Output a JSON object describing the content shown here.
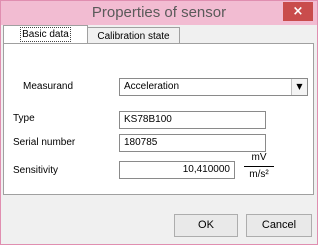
{
  "window": {
    "title": "Properties of sensor",
    "close_glyph": "×"
  },
  "tabs": [
    {
      "label": "Basic data",
      "selected": true
    },
    {
      "label": "Calibration state",
      "selected": false
    }
  ],
  "form": {
    "measurand_label": "Measurand",
    "measurand_value": "Acceleration",
    "type_label": "Type",
    "type_value": "KS78B100",
    "serial_label": "Serial number",
    "serial_value": "180785",
    "sensitivity_label": "Sensitivity",
    "sensitivity_value": "10,410000",
    "unit_numerator": "mV",
    "unit_denominator": "m/s²"
  },
  "buttons": {
    "ok_label": "OK",
    "cancel_label": "Cancel"
  },
  "icons": {
    "combo_arrow": "▼"
  },
  "colors": {
    "titlebar": "#f2bcd2",
    "close_button": "#c94c4c"
  }
}
